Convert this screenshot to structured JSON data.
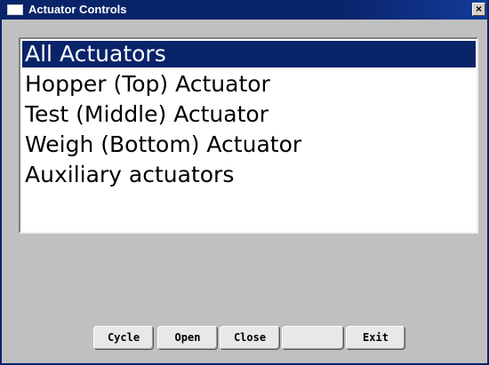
{
  "window": {
    "title": "Actuator Controls",
    "close_label": "×"
  },
  "actuator_list": {
    "items": [
      {
        "label": "All Actuators",
        "selected": true
      },
      {
        "label": "Hopper (Top) Actuator",
        "selected": false
      },
      {
        "label": "Test (Middle) Actuator",
        "selected": false
      },
      {
        "label": "Weigh (Bottom) Actuator",
        "selected": false
      },
      {
        "label": "Auxiliary actuators",
        "selected": false
      }
    ]
  },
  "buttons": {
    "cycle": "Cycle",
    "open": "Open",
    "close": "Close",
    "blank": "",
    "exit": "Exit"
  },
  "colors": {
    "titlebar": "#0a246a",
    "selection": "#0a246a",
    "window_background": "#c0c0c0"
  },
  "icons": {
    "window": "window-icon",
    "close": "close-icon"
  }
}
